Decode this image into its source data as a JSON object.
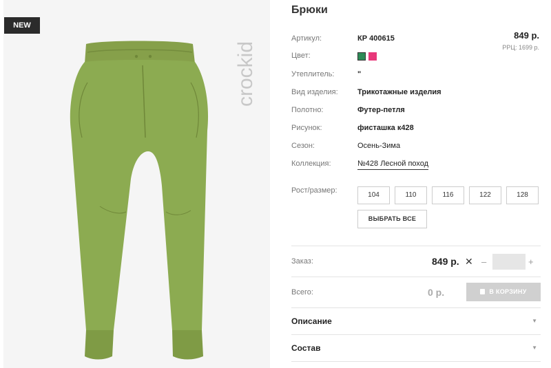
{
  "badge": "NEW",
  "brand": "crockid",
  "product": {
    "title": "Брюки",
    "price": "849 р.",
    "rrp": "РРЦ: 1699 р."
  },
  "attributes": {
    "sku_label": "Артикул:",
    "sku_value": "КР 400615",
    "color_label": "Цвет:",
    "insulation_label": "Утеплитель:",
    "insulation_value": "\"",
    "type_label": "Вид изделия:",
    "type_value": "Трикотажные изделия",
    "fabric_label": "Полотно:",
    "fabric_value": "Футер-петля",
    "pattern_label": "Рисунок:",
    "pattern_value": "фисташка к428",
    "season_label": "Сезон:",
    "season_value": "Осень-Зима",
    "collection_label": "Коллекция:",
    "collection_value": "№428 Лесной поход"
  },
  "colors": [
    "#2e8b57",
    "#e8387a"
  ],
  "sizes": {
    "label": "Рост/размер:",
    "options": [
      "104",
      "110",
      "116",
      "122",
      "128"
    ],
    "select_all": "ВЫБРАТЬ ВСЕ"
  },
  "order": {
    "label": "Заказ:",
    "price": "849 р.",
    "times": "✕",
    "minus": "–",
    "plus": "+",
    "quantity": ""
  },
  "total": {
    "label": "Всего:",
    "value": "0 р.",
    "cart_button": "В КОРЗИНУ"
  },
  "sections": {
    "description": "Описание",
    "composition": "Состав",
    "chevron": "▼"
  }
}
